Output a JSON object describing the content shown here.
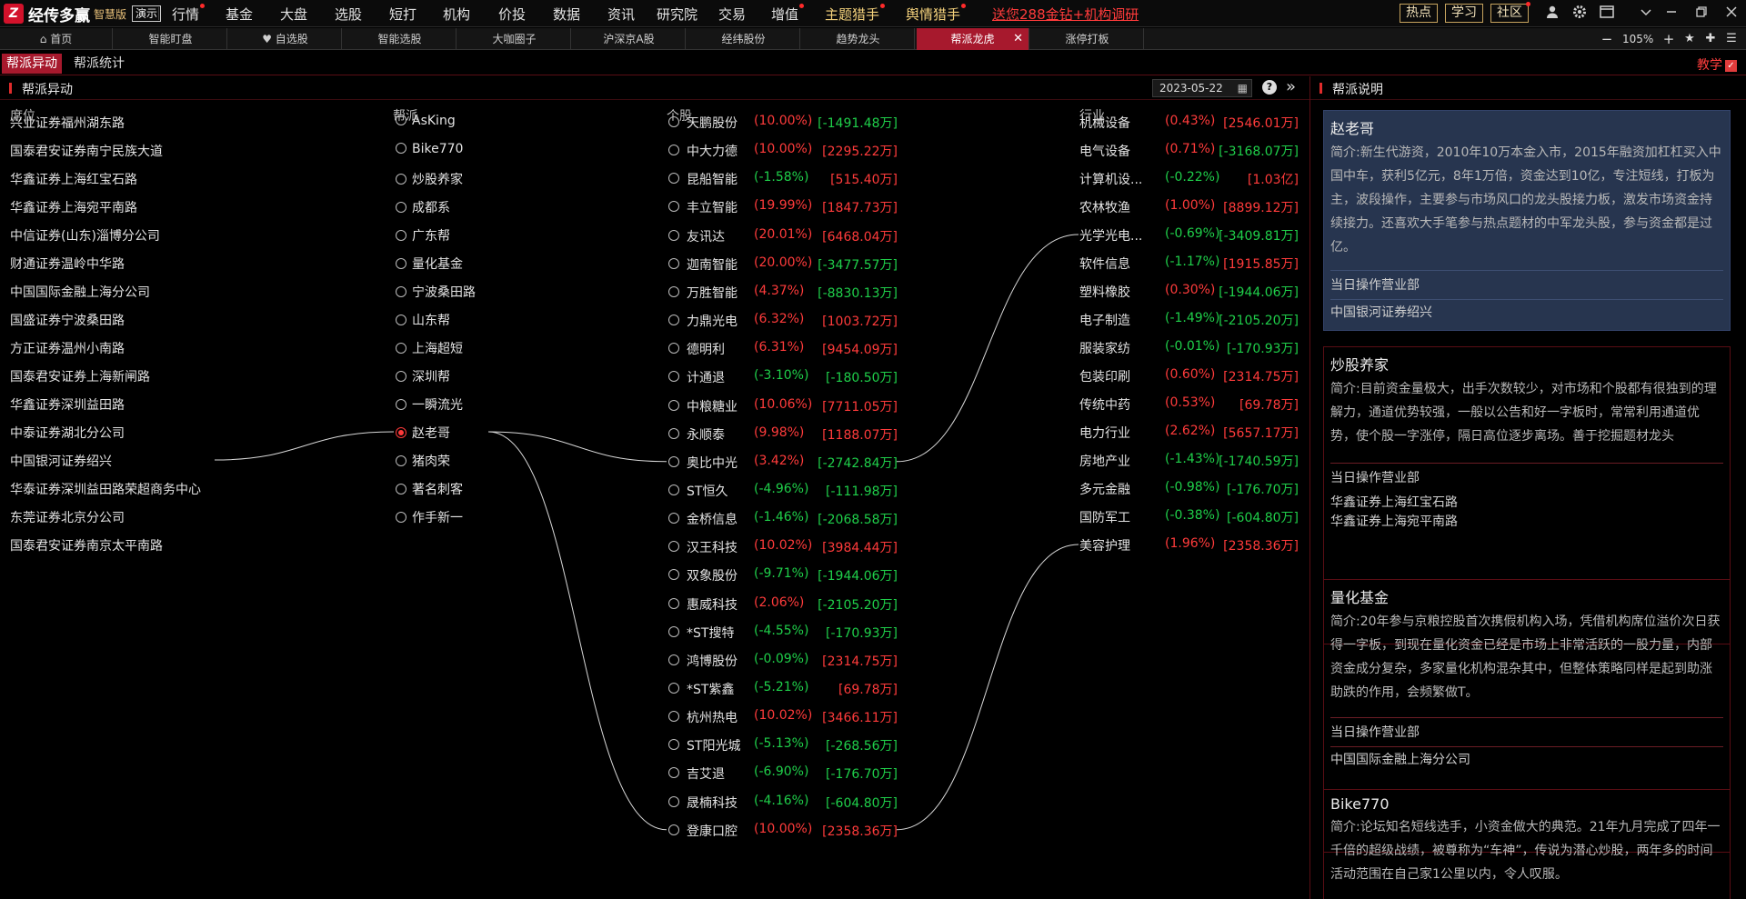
{
  "app": {
    "logo_mark": "Z",
    "name": "经传多赢",
    "edition": "智慧版",
    "demo": "演示"
  },
  "menu": [
    "行情",
    "基金",
    "大盘",
    "选股",
    "短打",
    "机构",
    "价投",
    "数据",
    "资讯",
    "研究院",
    "交易",
    "增值",
    "主题猎手",
    "舆情猎手"
  ],
  "promo": "送您288金钻+机构调研",
  "top_buttons": [
    "热点",
    "学习",
    "社区"
  ],
  "tabs": [
    "首页",
    "智能盯盘",
    "自选股",
    "智能选股",
    "大咖圈子",
    "沪深京A股",
    "经纬股份",
    "趋势龙头",
    "帮派龙虎",
    "涨停打板"
  ],
  "zoom": "105%",
  "subtabs": [
    "帮派异动",
    "帮派统计"
  ],
  "teach": "教学",
  "left": {
    "title": "帮派异动",
    "date": "2023-05-22",
    "headers": {
      "seat": "席位",
      "faction": "帮派",
      "stock": "个股",
      "industry": "行业"
    }
  },
  "seats": [
    "兴业证券福州湖东路",
    "国泰君安证券南宁民族大道",
    "华鑫证券上海红宝石路",
    "华鑫证券上海宛平南路",
    "中信证券(山东)淄博分公司",
    "财通证券温岭中华路",
    "中国国际金融上海分公司",
    "国盛证券宁波桑田路",
    "方正证券温州小南路",
    "国泰君安证券上海新闸路",
    "华鑫证券深圳益田路",
    "中泰证券湖北分公司",
    "中国银河证券绍兴",
    "华泰证券深圳益田路荣超商务中心",
    "东莞证券北京分公司",
    "国泰君安证券南京太平南路"
  ],
  "factions": [
    "AsKing",
    "Bike770",
    "炒股养家",
    "成都系",
    "广东帮",
    "量化基金",
    "宁波桑田路",
    "山东帮",
    "上海超短",
    "深圳帮",
    "一瞬流光",
    "赵老哥",
    "猪肉荣",
    "著名刺客",
    "作手新一"
  ],
  "selected_faction": "赵老哥",
  "stocks": [
    {
      "name": "天鹏股份",
      "pct": "(10.00%)",
      "amt": "[-1491.48万]",
      "pct_dir": "up",
      "amt_dir": "down"
    },
    {
      "name": "中大力德",
      "pct": "(10.00%)",
      "amt": "[2295.22万]",
      "pct_dir": "up",
      "amt_dir": "up"
    },
    {
      "name": "昆船智能",
      "pct": "(-1.58%)",
      "amt": "[515.40万]",
      "pct_dir": "down",
      "amt_dir": "up"
    },
    {
      "name": "丰立智能",
      "pct": "(19.99%)",
      "amt": "[1847.73万]",
      "pct_dir": "up",
      "amt_dir": "up"
    },
    {
      "name": "友讯达",
      "pct": "(20.01%)",
      "amt": "[6468.04万]",
      "pct_dir": "up",
      "amt_dir": "up"
    },
    {
      "name": "迦南智能",
      "pct": "(20.00%)",
      "amt": "[-3477.57万]",
      "pct_dir": "up",
      "amt_dir": "down"
    },
    {
      "name": "万胜智能",
      "pct": "(4.37%)",
      "amt": "[-8830.13万]",
      "pct_dir": "up",
      "amt_dir": "down"
    },
    {
      "name": "力鼎光电",
      "pct": "(6.32%)",
      "amt": "[1003.72万]",
      "pct_dir": "up",
      "amt_dir": "up"
    },
    {
      "name": "德明利",
      "pct": "(6.31%)",
      "amt": "[9454.09万]",
      "pct_dir": "up",
      "amt_dir": "up"
    },
    {
      "name": "计通退",
      "pct": "(-3.10%)",
      "amt": "[-180.50万]",
      "pct_dir": "down",
      "amt_dir": "down"
    },
    {
      "name": "中粮糖业",
      "pct": "(10.06%)",
      "amt": "[7711.05万]",
      "pct_dir": "up",
      "amt_dir": "up"
    },
    {
      "name": "永顺泰",
      "pct": "(9.98%)",
      "amt": "[1188.07万]",
      "pct_dir": "up",
      "amt_dir": "up"
    },
    {
      "name": "奥比中光",
      "pct": "(3.42%)",
      "amt": "[-2742.84万]",
      "pct_dir": "up",
      "amt_dir": "down"
    },
    {
      "name": "ST恒久",
      "pct": "(-4.96%)",
      "amt": "[-111.98万]",
      "pct_dir": "down",
      "amt_dir": "down"
    },
    {
      "name": "金桥信息",
      "pct": "(-1.46%)",
      "amt": "[-2068.58万]",
      "pct_dir": "down",
      "amt_dir": "down"
    },
    {
      "name": "汉王科技",
      "pct": "(10.02%)",
      "amt": "[3984.44万]",
      "pct_dir": "up",
      "amt_dir": "up"
    },
    {
      "name": "双象股份",
      "pct": "(-9.71%)",
      "amt": "[-1944.06万]",
      "pct_dir": "down",
      "amt_dir": "down"
    },
    {
      "name": "惠威科技",
      "pct": "(2.06%)",
      "amt": "[-2105.20万]",
      "pct_dir": "up",
      "amt_dir": "down"
    },
    {
      "name": "*ST搜特",
      "pct": "(-4.55%)",
      "amt": "[-170.93万]",
      "pct_dir": "down",
      "amt_dir": "down"
    },
    {
      "name": "鸿博股份",
      "pct": "(-0.09%)",
      "amt": "[2314.75万]",
      "pct_dir": "down",
      "amt_dir": "up"
    },
    {
      "name": "*ST紫鑫",
      "pct": "(-5.21%)",
      "amt": "[69.78万]",
      "pct_dir": "down",
      "amt_dir": "up"
    },
    {
      "name": "杭州热电",
      "pct": "(10.02%)",
      "amt": "[3466.11万]",
      "pct_dir": "up",
      "amt_dir": "up"
    },
    {
      "name": "ST阳光城",
      "pct": "(-5.13%)",
      "amt": "[-268.56万]",
      "pct_dir": "down",
      "amt_dir": "down"
    },
    {
      "name": "吉艾退",
      "pct": "(-6.90%)",
      "amt": "[-176.70万]",
      "pct_dir": "down",
      "amt_dir": "down"
    },
    {
      "name": "晟楠科技",
      "pct": "(-4.16%)",
      "amt": "[-604.80万]",
      "pct_dir": "down",
      "amt_dir": "down"
    },
    {
      "name": "登康口腔",
      "pct": "(10.00%)",
      "amt": "[2358.36万]",
      "pct_dir": "up",
      "amt_dir": "up"
    }
  ],
  "industries": [
    {
      "name": "机械设备",
      "pct": "(0.43%)",
      "amt": "[2546.01万]",
      "pct_dir": "up",
      "amt_dir": "up"
    },
    {
      "name": "电气设备",
      "pct": "(0.71%)",
      "amt": "[-3168.07万]",
      "pct_dir": "up",
      "amt_dir": "down"
    },
    {
      "name": "计算机设...",
      "pct": "(-0.22%)",
      "amt": "[1.03亿]",
      "pct_dir": "down",
      "amt_dir": "up"
    },
    {
      "name": "农林牧渔",
      "pct": "(1.00%)",
      "amt": "[8899.12万]",
      "pct_dir": "up",
      "amt_dir": "up"
    },
    {
      "name": "光学光电...",
      "pct": "(-0.69%)",
      "amt": "[-3409.81万]",
      "pct_dir": "down",
      "amt_dir": "down"
    },
    {
      "name": "软件信息",
      "pct": "(-1.17%)",
      "amt": "[1915.85万]",
      "pct_dir": "down",
      "amt_dir": "up"
    },
    {
      "name": "塑料橡胶",
      "pct": "(0.30%)",
      "amt": "[-1944.06万]",
      "pct_dir": "up",
      "amt_dir": "down"
    },
    {
      "name": "电子制造",
      "pct": "(-1.49%)",
      "amt": "[-2105.20万]",
      "pct_dir": "down",
      "amt_dir": "down"
    },
    {
      "name": "服装家纺",
      "pct": "(-0.01%)",
      "amt": "[-170.93万]",
      "pct_dir": "down",
      "amt_dir": "down"
    },
    {
      "name": "包装印刷",
      "pct": "(0.60%)",
      "amt": "[2314.75万]",
      "pct_dir": "up",
      "amt_dir": "up"
    },
    {
      "name": "传统中药",
      "pct": "(0.53%)",
      "amt": "[69.78万]",
      "pct_dir": "up",
      "amt_dir": "up"
    },
    {
      "name": "电力行业",
      "pct": "(2.62%)",
      "amt": "[5657.17万]",
      "pct_dir": "up",
      "amt_dir": "up"
    },
    {
      "name": "房地产业",
      "pct": "(-1.43%)",
      "amt": "[-1740.59万]",
      "pct_dir": "down",
      "amt_dir": "down"
    },
    {
      "name": "多元金融",
      "pct": "(-0.98%)",
      "amt": "[-176.70万]",
      "pct_dir": "down",
      "amt_dir": "down"
    },
    {
      "name": "国防军工",
      "pct": "(-0.38%)",
      "amt": "[-604.80万]",
      "pct_dir": "down",
      "amt_dir": "down"
    },
    {
      "name": "美容护理",
      "pct": "(1.96%)",
      "amt": "[2358.36万]",
      "pct_dir": "up",
      "amt_dir": "up"
    }
  ],
  "links": {
    "seat_to_faction": [
      [
        12,
        11
      ]
    ],
    "faction_to_stock": [
      [
        11,
        12
      ],
      [
        11,
        25
      ]
    ],
    "stock_to_industry": [
      [
        12,
        4
      ],
      [
        25,
        15
      ]
    ]
  },
  "right": {
    "title": "帮派说明",
    "cards": [
      {
        "name": "赵老哥",
        "desc": "简介:新生代游资，2010年10万本金入市，2015年融资加杠杠买入中国中车，获利5亿元，8年1万倍，资金达到10亿，专注短线，打板为主，波段操作，主要参与市场风口的龙头股接力板，激发市场资金持续接力。还喜欢大手笔参与热点题材的中军龙头股，参与资金都是过亿。",
        "sub": "当日操作营业部",
        "depts": [
          "中国银河证券绍兴"
        ]
      },
      {
        "name": "炒股养家",
        "desc": "简介:目前资金量极大，出手次数较少，对市场和个股都有很独到的理解力，通道优势较强，一般以公告和好一字板时，常常利用通道优势，使个股一字涨停，隔日高位逐步离场。善于挖掘题材龙头",
        "sub": "当日操作营业部",
        "depts": [
          "华鑫证券上海红宝石路",
          "华鑫证券上海宛平南路"
        ]
      },
      {
        "name": "量化基金",
        "desc": "简介:20年参与京粮控股首次携假机构入场，凭借机构席位溢价次日获得一字板，到现在量化资金已经是市场上非常活跃的一股力量，内部资金成分复杂，多家量化机构混杂其中，但整体策略同样是起到助涨助跌的作用，会频繁做T。",
        "sub": "当日操作营业部",
        "depts": [
          "中国国际金融上海分公司"
        ]
      },
      {
        "name": "Bike770",
        "desc": "简介:论坛知名短线选手，小资金做大的典范。21年九月完成了四年一千倍的超级战绩，被尊称为“车神”，传说为潜心炒股，两年多的时间活动范围在自己家1公里以内，令人叹服。",
        "sub": "",
        "depts": []
      }
    ]
  },
  "colors": {
    "up": "#ff3b3b",
    "down": "#1fcf4a",
    "accent": "#a7192d",
    "card_active": "#27354f"
  }
}
